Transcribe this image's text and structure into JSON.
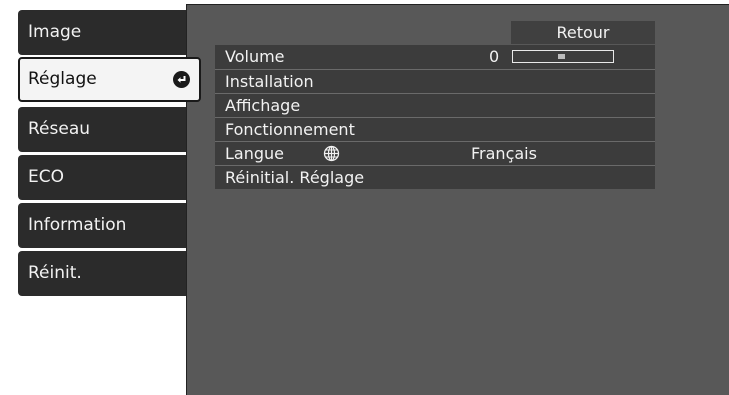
{
  "sidebar": {
    "items": [
      {
        "label": "Image"
      },
      {
        "label": "Réglage",
        "active": true,
        "icon": "enter-icon"
      },
      {
        "label": "Réseau"
      },
      {
        "label": "ECO"
      },
      {
        "label": "Information"
      },
      {
        "label": "Réinit."
      }
    ]
  },
  "panel": {
    "back_label": "Retour",
    "rows": [
      {
        "label": "Volume",
        "value": "0",
        "slider_level": 0
      },
      {
        "label": "Installation"
      },
      {
        "label": "Affichage"
      },
      {
        "label": "Fonctionnement"
      },
      {
        "label": "Langue",
        "icon": "globe-icon",
        "value": "Français"
      },
      {
        "label": "Réinitial. Réglage"
      }
    ]
  },
  "colors": {
    "panel_bg": "#585858",
    "row_bg": "#3c3c3c",
    "sidebar_bg": "#2b2b2b",
    "active_bg": "#f4f4f4",
    "text_light": "#f2f2f2"
  }
}
